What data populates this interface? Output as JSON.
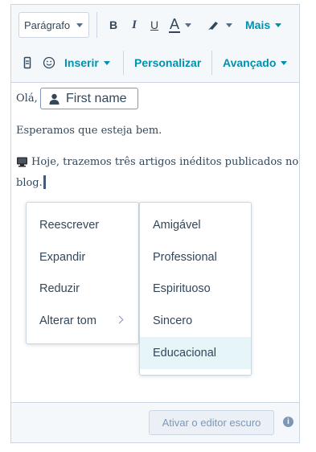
{
  "toolbar": {
    "paragraph_select": "Parágrafo",
    "bold_label": "B",
    "italic_label": "I",
    "underline_label": "U",
    "text_color_label": "A",
    "more_label": "Mais",
    "insert_label": "Inserir",
    "customize_label": "Personalizar",
    "advanced_label": "Avançado"
  },
  "content": {
    "greeting": "Olá,",
    "personalization_token": "First name",
    "line1": "Esperamos que esteja bem.",
    "line2_part1": "Hoje, trazemos três artigos inéditos publicados no",
    "line2_part2": "blog."
  },
  "ai_menu": {
    "items": [
      {
        "label": "Reescrever"
      },
      {
        "label": "Expandir"
      },
      {
        "label": "Reduzir"
      },
      {
        "label": "Alterar tom"
      }
    ]
  },
  "tone_menu": {
    "items": [
      {
        "label": "Amigável"
      },
      {
        "label": "Professional"
      },
      {
        "label": "Espirituoso"
      },
      {
        "label": "Sincero"
      },
      {
        "label": "Educacional",
        "selected": true
      }
    ]
  },
  "footer": {
    "dark_editor_button": "Ativar o editor escuro",
    "info_icon": "i"
  },
  "colors": {
    "accent": "#0091ae",
    "text": "#33475b",
    "border": "#cbd6e2",
    "toolbar_bg": "#f5f8fa",
    "selected_bg": "#e5f5f8"
  }
}
